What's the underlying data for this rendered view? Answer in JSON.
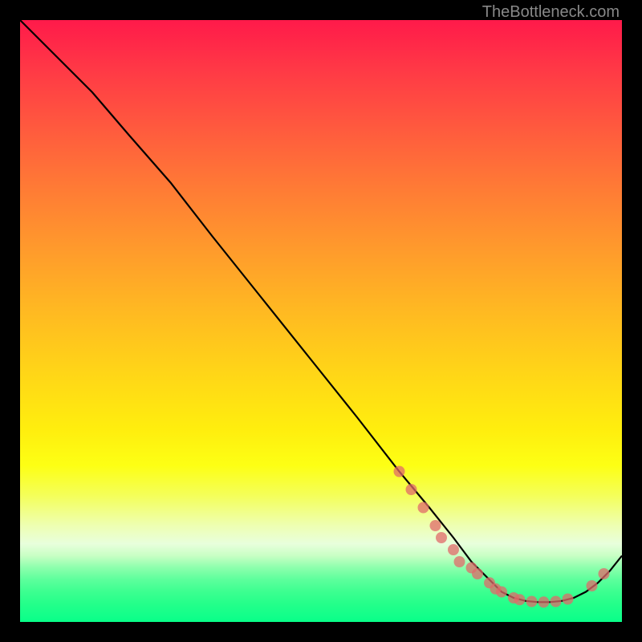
{
  "watermark": "TheBottleneck.com",
  "colors": {
    "gradient_top": "#ff1a4a",
    "gradient_bottom": "#08ff88",
    "curve": "#000000",
    "marker": "#e06a6a"
  },
  "chart_data": {
    "type": "line",
    "title": "",
    "xlabel": "",
    "ylabel": "",
    "x_range": [
      0,
      100
    ],
    "y_range": [
      0,
      100
    ],
    "note": "Axes are unlabeled in the source image; values are fractional positions (0–100) estimated from pixel geometry. The curve represents a bottleneck-style metric that descends from top-left, reaches a minimum near x≈82, and rises again toward the right edge.",
    "series": [
      {
        "name": "curve",
        "x": [
          0,
          3,
          7,
          12,
          18,
          25,
          32,
          40,
          48,
          56,
          63,
          68,
          72,
          75,
          78,
          80,
          82,
          84,
          86,
          88,
          90,
          92,
          94,
          96,
          98,
          100
        ],
        "y": [
          100,
          97,
          93,
          88,
          81,
          73,
          64,
          54,
          44,
          34,
          25,
          19,
          14,
          10,
          7,
          5,
          4,
          3.5,
          3.3,
          3.3,
          3.5,
          4,
          5,
          6.5,
          8.5,
          11
        ]
      }
    ],
    "markers": [
      {
        "x": 63,
        "y": 25
      },
      {
        "x": 65,
        "y": 22
      },
      {
        "x": 67,
        "y": 19
      },
      {
        "x": 69,
        "y": 16
      },
      {
        "x": 70,
        "y": 14
      },
      {
        "x": 72,
        "y": 12
      },
      {
        "x": 73,
        "y": 10
      },
      {
        "x": 75,
        "y": 9
      },
      {
        "x": 76,
        "y": 8
      },
      {
        "x": 78,
        "y": 6.5
      },
      {
        "x": 79,
        "y": 5.5
      },
      {
        "x": 80,
        "y": 5
      },
      {
        "x": 82,
        "y": 4
      },
      {
        "x": 83,
        "y": 3.7
      },
      {
        "x": 85,
        "y": 3.4
      },
      {
        "x": 87,
        "y": 3.3
      },
      {
        "x": 89,
        "y": 3.4
      },
      {
        "x": 91,
        "y": 3.8
      },
      {
        "x": 95,
        "y": 6
      },
      {
        "x": 97,
        "y": 8
      }
    ]
  }
}
